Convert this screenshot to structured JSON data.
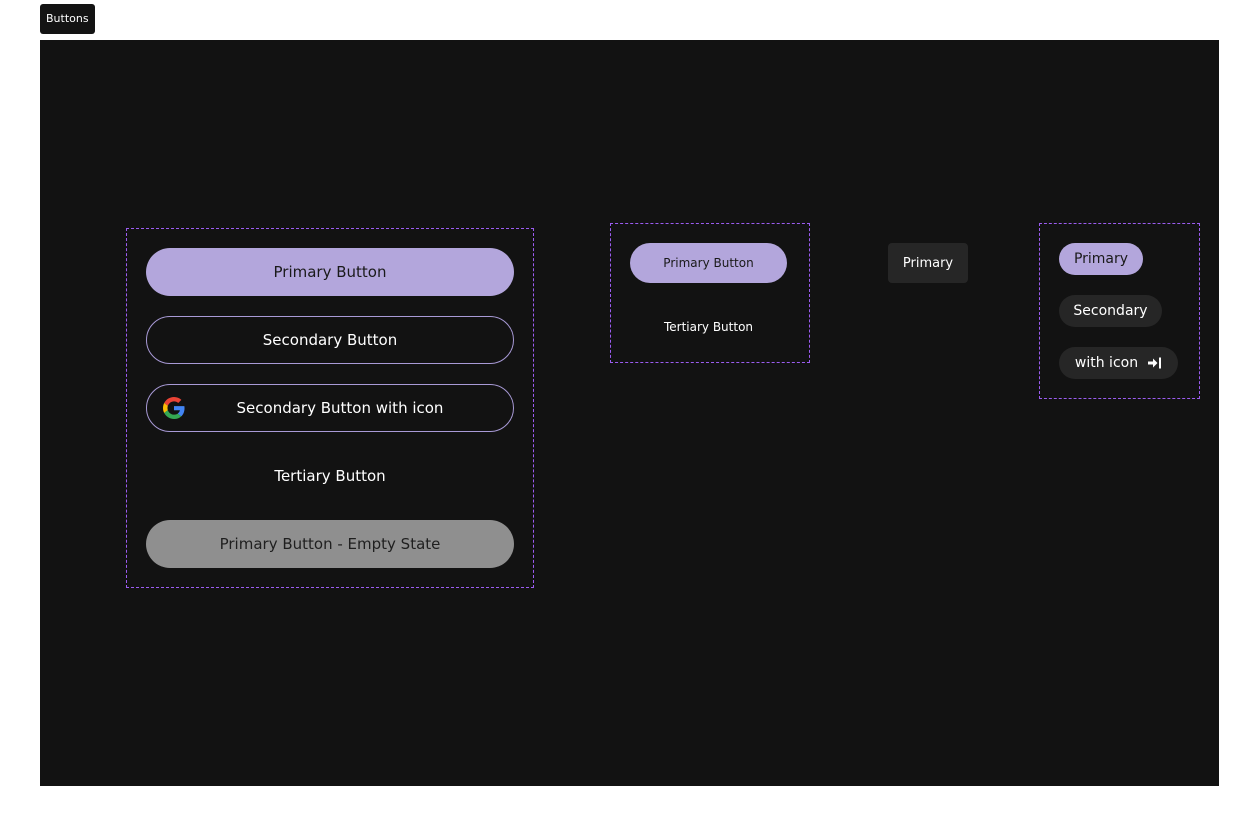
{
  "frame": {
    "label": "Buttons"
  },
  "group_large": {
    "primary": "Primary Button",
    "secondary": "Secondary Button",
    "secondary_icon": "Secondary Button with icon",
    "tertiary": "Tertiary Button",
    "empty": "Primary Button - Empty State"
  },
  "group_small": {
    "primary": "Primary Button",
    "tertiary": "Tertiary Button"
  },
  "standalone": {
    "primary": "Primary"
  },
  "chips": {
    "primary": "Primary",
    "secondary": "Secondary",
    "with_icon": "with icon"
  },
  "icons": {
    "google": "google-icon",
    "sign_in": "sign-in-icon"
  },
  "colors": {
    "canvas": "#121212",
    "primary": "#b3a6dc",
    "outline": "#a89ad6",
    "empty": "#8f8f8f",
    "dark_button": "#262626",
    "group_border": "#9b5cf0"
  }
}
